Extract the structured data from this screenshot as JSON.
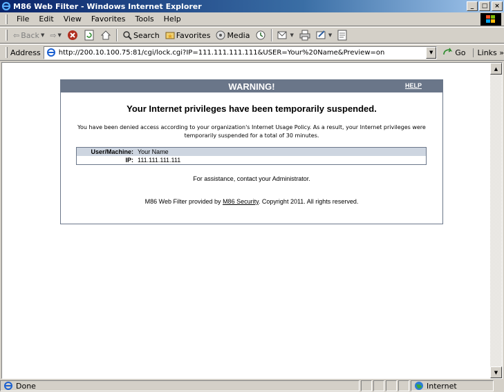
{
  "window": {
    "title": "M86 Web Filter - Windows Internet Explorer",
    "buttons": {
      "minimize": "_",
      "maximize": "□",
      "close": "×"
    }
  },
  "menu": {
    "items": [
      "File",
      "Edit",
      "View",
      "Favorites",
      "Tools",
      "Help"
    ]
  },
  "toolbar": {
    "back_label": "Back",
    "search_label": "Search",
    "favorites_label": "Favorites",
    "media_label": "Media"
  },
  "address_bar": {
    "label": "Address",
    "url": "http://200.10.100.75:81/cgi/lock.cgi?IP=111.111.111.111&USER=Your%20Name&Preview=on",
    "go_label": "Go",
    "links_label": "Links »"
  },
  "page": {
    "header": "WARNING!",
    "help_link": "HELP",
    "headline": "Your Internet privileges have been temporarily suspended.",
    "body_line1": "You have been denied access according to your organization's Internet Usage Policy. As a result, your Internet privileges were",
    "body_line2": "temporarily suspended for a total of 30 minutes.",
    "info": {
      "user_label": "User/Machine:",
      "user_value": "Your Name",
      "ip_label": "IP:",
      "ip_value": "111.111.111.111"
    },
    "assistance": "For assistance, contact your Administrator.",
    "footer_prefix": "M86 Web Filter provided by ",
    "footer_link": "M86 Security",
    "footer_suffix": ". Copyright 2011. All rights reserved."
  },
  "status": {
    "text": "Done",
    "zone": "Internet"
  },
  "colors": {
    "panel_header": "#6a7689",
    "info_shade": "#cdd5e0"
  }
}
